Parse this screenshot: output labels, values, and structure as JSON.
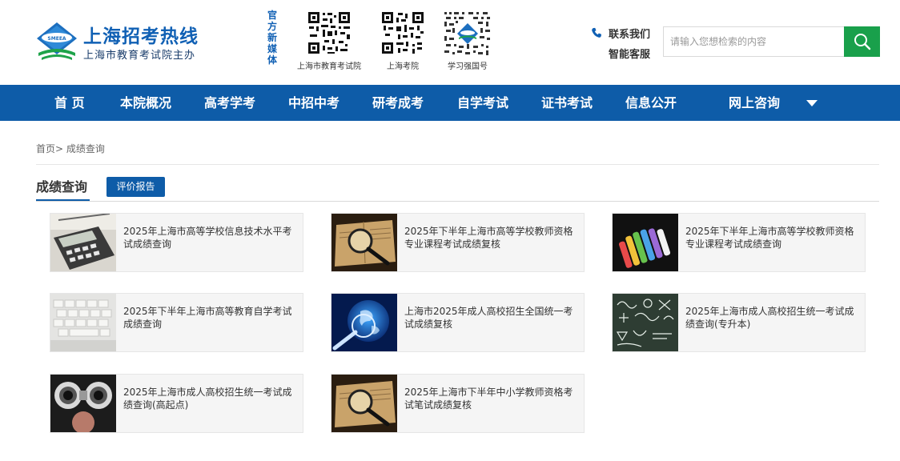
{
  "header": {
    "logo_badge": "SMEEA",
    "logo_title": "上海招考热线",
    "logo_subtitle": "上海市教育考试院主办",
    "media_label": "官方新媒体",
    "qr_codes": [
      {
        "caption": "上海市教育考试院"
      },
      {
        "caption": "上海考院"
      },
      {
        "caption": "学习强国号"
      }
    ],
    "contact_label": "联系我们",
    "service_label": "智能客服",
    "search_placeholder": "请输入您想检索的内容"
  },
  "nav": {
    "items": [
      {
        "label": "首 页"
      },
      {
        "label": "本院概况"
      },
      {
        "label": "高考学考"
      },
      {
        "label": "中招中考"
      },
      {
        "label": "研考成考"
      },
      {
        "label": "自学考试"
      },
      {
        "label": "证书考试"
      },
      {
        "label": "信息公开"
      },
      {
        "label": "网上咨询"
      }
    ]
  },
  "breadcrumb": "首页> 成绩查询",
  "section": {
    "title": "成绩查询",
    "report_button": "评价报告"
  },
  "cards": [
    {
      "title": "2025年上海市高等学校信息技术水平考试成绩查询",
      "thumb": "calculator"
    },
    {
      "title": "2025年下半年上海市高等学校教师资格专业课程考试成绩复核",
      "thumb": "magnifier"
    },
    {
      "title": "2025年下半年上海市高等学校教师资格专业课程考试成绩查询",
      "thumb": "chalk"
    },
    {
      "title": "2025年下半年上海市高等教育自学考试成绩查询",
      "thumb": "keyboard"
    },
    {
      "title": "上海市2025年成人高校招生全国统一考试成绩复核",
      "thumb": "globe"
    },
    {
      "title": "2025年上海市成人高校招生统一考试成绩查询(专升本)",
      "thumb": "blackboard"
    },
    {
      "title": "2025年上海市成人高校招生统一考试成绩查询(高起点)",
      "thumb": "binoculars"
    },
    {
      "title": "2025年上海市下半年中小学教师资格考试笔试成绩复核",
      "thumb": "magnifier"
    }
  ],
  "colors": {
    "brand_blue": "#0e5ca8",
    "search_green": "#19a04b",
    "card_bg": "#f5f5f5"
  }
}
